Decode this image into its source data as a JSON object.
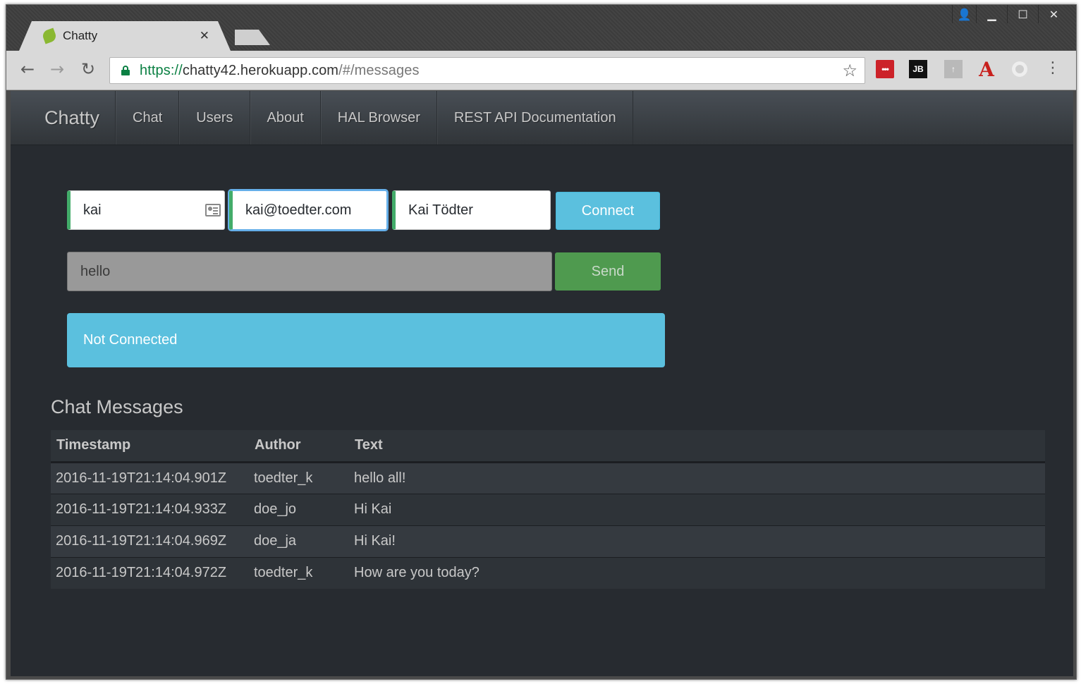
{
  "browser": {
    "tab_title": "Chatty",
    "tab_close": "✕",
    "url_scheme": "https://",
    "url_host": "chatty42.herokuapp.com",
    "url_path": "/#/messages",
    "window_buttons": {
      "user": "👤",
      "minimize": "▁",
      "maximize": "☐",
      "close": "✕"
    },
    "nav": {
      "back": "←",
      "forward": "→",
      "reload": "↻"
    },
    "star": "☆",
    "menu": "⋮",
    "extensions": {
      "lastpass": "•••",
      "jetbrains": "JB",
      "upload": "↑",
      "acrobat": "A"
    }
  },
  "navbar": {
    "brand": "Chatty",
    "links": [
      "Chat",
      "Users",
      "About",
      "HAL Browser",
      "REST API Documentation"
    ]
  },
  "form": {
    "username": "kai",
    "email": "kai@toedter.com",
    "fullname": "Kai Tödter",
    "connect_label": "Connect",
    "message": "hello",
    "send_label": "Send"
  },
  "status": {
    "text": "Not Connected"
  },
  "messages": {
    "title": "Chat Messages",
    "headers": [
      "Timestamp",
      "Author",
      "Text"
    ],
    "rows": [
      [
        "2016-11-19T21:14:04.901Z",
        "toedter_k",
        "hello all!"
      ],
      [
        "2016-11-19T21:14:04.933Z",
        "doe_jo",
        "Hi Kai"
      ],
      [
        "2016-11-19T21:14:04.969Z",
        "doe_ja",
        "Hi Kai!"
      ],
      [
        "2016-11-19T21:14:04.972Z",
        "toedter_k",
        "How are you today?"
      ]
    ]
  },
  "colors": {
    "page_bg": "#272b30",
    "info": "#5bc0de",
    "success": "#43ac6a",
    "send_button": "#4f9a4f"
  }
}
